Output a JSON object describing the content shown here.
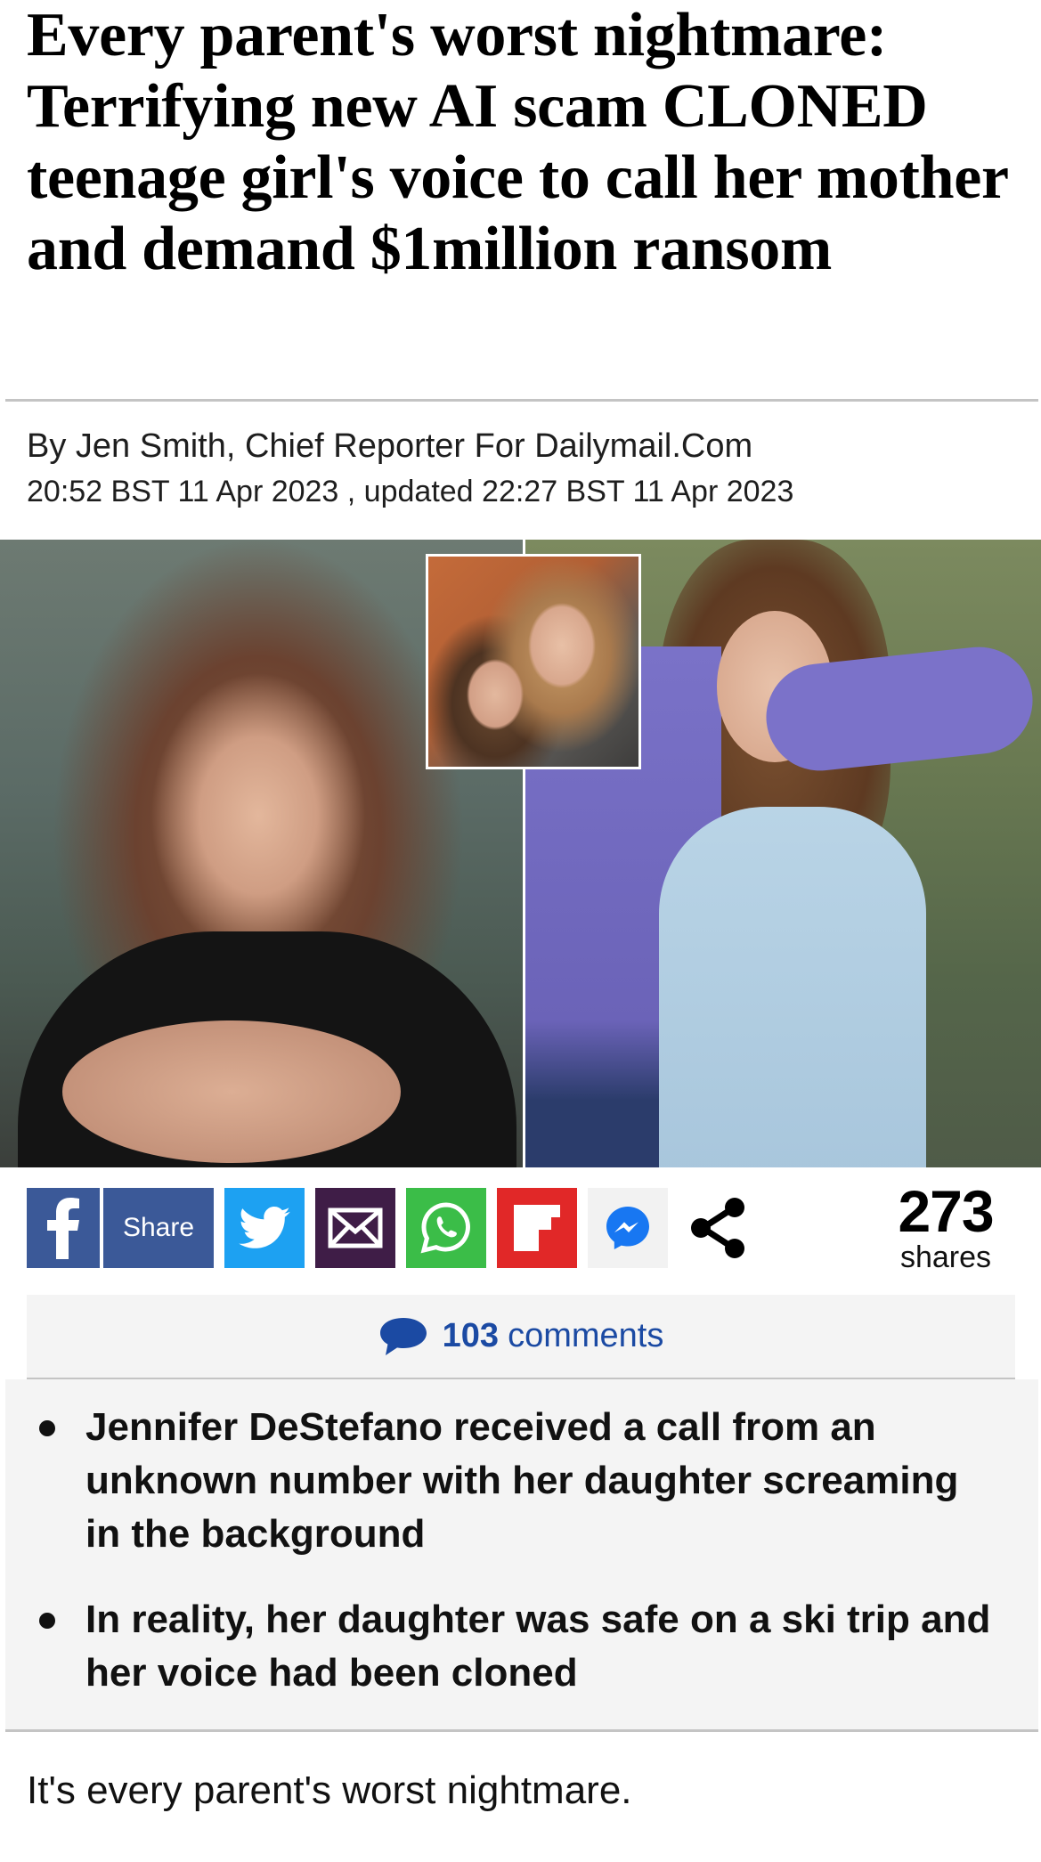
{
  "article": {
    "headline": "Every parent's worst nightmare: Terrifying new AI scam CLONED teenage girl's voice to call her mother and demand $1million ransom",
    "byline": "By Jen Smith, Chief Reporter For Dailymail.Com",
    "dateline": "20:52 BST 11 Apr 2023 , updated 22:27 BST 11 Apr 2023",
    "body_first_line": "It's every parent's worst nightmare."
  },
  "share": {
    "facebook_share_label": "Share",
    "count": "273",
    "count_label": "shares",
    "icons": [
      "facebook-icon",
      "twitter-icon",
      "email-icon",
      "whatsapp-icon",
      "flipboard-icon",
      "messenger-icon",
      "share-icon"
    ],
    "colors": {
      "facebook": "#3b5998",
      "twitter": "#1da1f2",
      "email": "#3f1d47",
      "whatsapp": "#3bbd48",
      "flipboard": "#e12828",
      "messenger": "#f2f2f2"
    }
  },
  "comments": {
    "count": "103",
    "label": "comments",
    "color": "#1b4aa3"
  },
  "bullets": [
    "Jennifer DeStefano received a call from an unknown number with her daughter screaming in the background",
    "In reality, her daughter was safe on a ski trip and her voice had been cloned"
  ]
}
